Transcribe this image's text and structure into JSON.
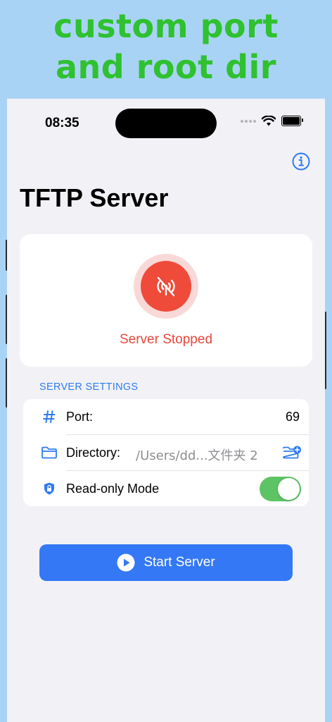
{
  "promo": {
    "line1": "custom port",
    "line2": "and root dir"
  },
  "status_bar": {
    "time": "08:35"
  },
  "header": {
    "title": "TFTP Server"
  },
  "server_status": {
    "text": "Server Stopped",
    "icon": "antenna-off-icon"
  },
  "settings": {
    "section_title": "SERVER SETTINGS",
    "port": {
      "label": "Port:",
      "value": "69",
      "icon": "hash-icon"
    },
    "directory": {
      "label": "Directory:",
      "value": "/Users/dd...文件夹 2",
      "icon": "folder-icon"
    },
    "read_only": {
      "label": "Read-only Mode",
      "enabled": true,
      "icon": "lock-shield-icon"
    }
  },
  "start_button": {
    "label": "Start Server",
    "icon": "play-circle-icon"
  },
  "colors": {
    "promo_green": "#2fc12f",
    "background_blue": "#a9d3f5",
    "accent_blue": "#3478f6",
    "status_red": "#ef4b3a",
    "toggle_green": "#5dc466"
  }
}
